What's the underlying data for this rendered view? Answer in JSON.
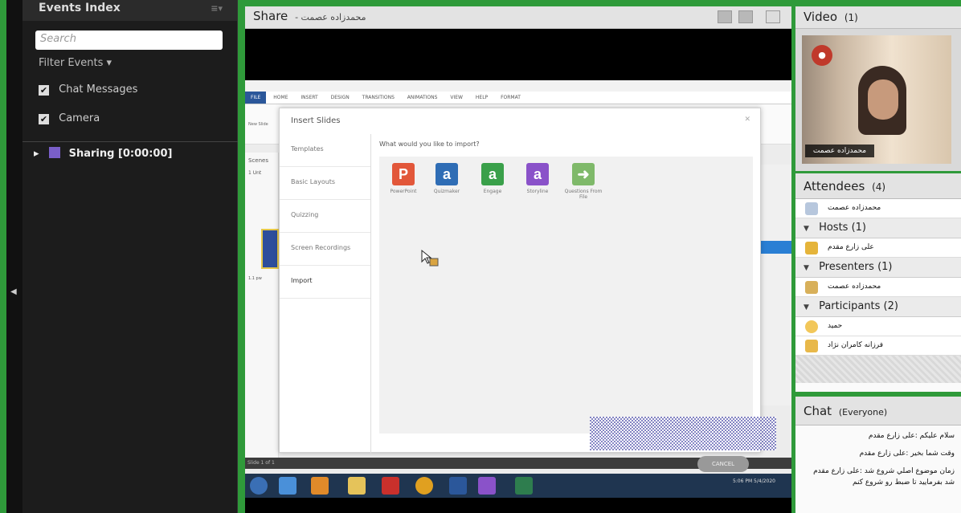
{
  "events": {
    "title": "Events Index",
    "search_placeholder": "Search",
    "filter_label": "Filter Events",
    "options": [
      {
        "label": "Chat Messages",
        "checked": true
      },
      {
        "label": "Camera",
        "checked": true
      }
    ],
    "sharing_item": "Sharing [0:00:00]"
  },
  "share": {
    "title": "Share",
    "presenter": "محمدزاده عصمت",
    "screen": {
      "ribbon_tabs": [
        "FILE",
        "HOME",
        "INSERT",
        "DESIGN",
        "TRANSITIONS",
        "ANIMATIONS",
        "VIEW",
        "HELP",
        "FORMAT"
      ],
      "side_labels": [
        "New Slide",
        "Scenes",
        "1 Unt",
        "1.1 pw"
      ],
      "status_text": "Slide 1 of 1",
      "dialog": {
        "title": "Insert Slides",
        "prompt": "What would you like to import?",
        "categories": [
          "Templates",
          "Basic Layouts",
          "Quizzing",
          "Screen Recordings",
          "Import"
        ],
        "active_category": "Import",
        "import_options": [
          {
            "label": "PowerPoint",
            "icon": "powerpoint-icon",
            "glyph": "P",
            "color": "#e2573a"
          },
          {
            "label": "Quizmaker",
            "icon": "quizmaker-icon",
            "glyph": "a",
            "color": "#2f6db5"
          },
          {
            "label": "Engage",
            "icon": "engage-icon",
            "glyph": "a",
            "color": "#3aa04a"
          },
          {
            "label": "Storyline",
            "icon": "storyline-icon",
            "glyph": "a",
            "color": "#8a52c9"
          },
          {
            "label": "Questions From File",
            "icon": "questions-file-icon",
            "glyph": "➜",
            "color": "#7fb96a"
          }
        ],
        "cancel_label": "CANCEL"
      },
      "clock": "5:06 PM 5/4/2020"
    }
  },
  "video": {
    "title": "Video",
    "count": "(1)",
    "name_tag": "محمدزاده عصمت"
  },
  "attendees": {
    "title": "Attendees",
    "count": "(4)",
    "top_user": "محمدزاده عصمت",
    "groups": [
      {
        "label": "Hosts (1)",
        "members": [
          "على زارع مقدم"
        ]
      },
      {
        "label": "Presenters (1)",
        "members": [
          "محمدزاده عصمت"
        ]
      },
      {
        "label": "Participants (2)",
        "members": [
          "حميد",
          "فرزانه كامران نژاد"
        ]
      }
    ]
  },
  "chat": {
    "title": "Chat",
    "scope": "(Everyone)",
    "messages": [
      "سلام عليكم :على زارع مقدم",
      "وقت شما بخير :على زارع مقدم",
      "زمان موضوع اصلي شروع شد :على زارع مقدم",
      "شد بفرماييد تا ضبط رو شروع كنم"
    ]
  },
  "colors": {
    "frame_green": "#2f9a3a",
    "dark_panel": "#1c1c1c",
    "pod_header": "#e3e3e3"
  }
}
